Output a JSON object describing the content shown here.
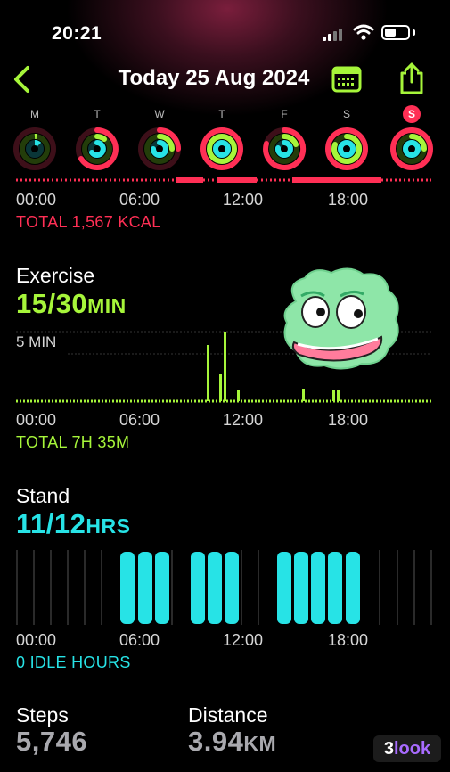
{
  "status": {
    "time": "20:21"
  },
  "header": {
    "title": "Today 25 Aug 2024"
  },
  "week": {
    "days": [
      {
        "letter": "M",
        "today": false
      },
      {
        "letter": "T",
        "today": false
      },
      {
        "letter": "W",
        "today": false
      },
      {
        "letter": "T",
        "today": false
      },
      {
        "letter": "F",
        "today": false
      },
      {
        "letter": "S",
        "today": false
      },
      {
        "letter": "S",
        "today": true
      }
    ]
  },
  "move": {
    "axis": [
      "00:00",
      "06:00",
      "12:00",
      "18:00"
    ],
    "total": "TOTAL 1,567 KCAL",
    "color": "#ff2f55"
  },
  "exercise": {
    "title": "Exercise",
    "value": "15/30",
    "unit": "MIN",
    "scale_label": "5 MIN",
    "axis": [
      "00:00",
      "06:00",
      "12:00",
      "18:00"
    ],
    "total": "TOTAL 7H 35M",
    "color": "#a6f53a"
  },
  "stand": {
    "title": "Stand",
    "value": "11/12",
    "unit": "HRS",
    "axis": [
      "00:00",
      "06:00",
      "12:00",
      "18:00"
    ],
    "idle": "0 IDLE HOURS",
    "color": "#27e3e6"
  },
  "steps": {
    "label": "Steps",
    "value": "5,746"
  },
  "distance": {
    "label": "Distance",
    "value": "3.94",
    "unit": "KM"
  },
  "watermark": {
    "text": "3look"
  },
  "icons": [
    "back-chevron-icon",
    "calendar-icon",
    "share-icon",
    "signal-icon",
    "wifi-icon",
    "battery-icon",
    "sticker-face"
  ]
}
